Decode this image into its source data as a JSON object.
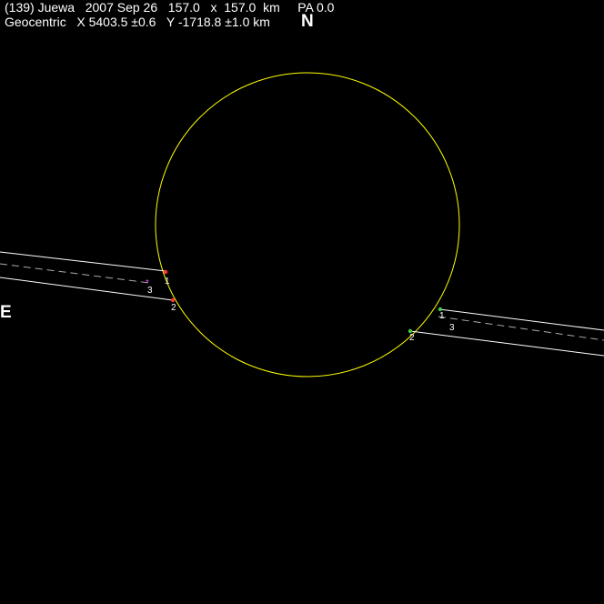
{
  "header": {
    "line1": "(139) Juewa   2007 Sep 26   157.0   x  157.0  km     PA 0.0",
    "line2": "Geocentric   X 5403.5 ±0.6   Y -1718.8 ±1.0 km"
  },
  "north_label": "N",
  "east_label": "E",
  "colors": {
    "background": "#000000",
    "outline": "#ffff00",
    "chords": "#ffffff",
    "marker_disappear": "#ff3333",
    "marker_reappear": "#44cc44",
    "marker_center": "#ff44ff"
  },
  "chord_labels": {
    "left": [
      "1",
      "2",
      "3"
    ],
    "right": [
      "1",
      "2",
      "3"
    ]
  }
}
